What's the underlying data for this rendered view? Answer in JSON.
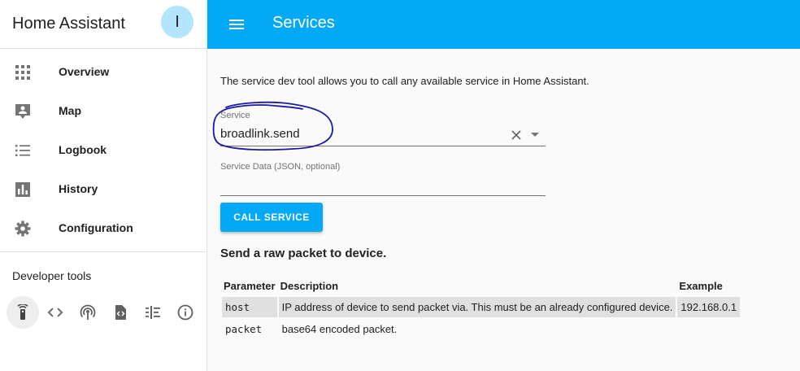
{
  "app": {
    "title": "Home Assistant",
    "avatar_initial": "I"
  },
  "sidebar": {
    "items": [
      {
        "label": "Overview",
        "icon": "grid-icon"
      },
      {
        "label": "Map",
        "icon": "map-marker-icon"
      },
      {
        "label": "Logbook",
        "icon": "list-icon"
      },
      {
        "label": "History",
        "icon": "chart-bar-icon"
      },
      {
        "label": "Configuration",
        "icon": "gear-icon"
      }
    ],
    "dev_tools_label": "Developer tools",
    "dev_tools": [
      {
        "icon": "remote-icon",
        "active": true
      },
      {
        "icon": "code-icon",
        "active": false
      },
      {
        "icon": "broadcast-icon",
        "active": false
      },
      {
        "icon": "file-code-icon",
        "active": false
      },
      {
        "icon": "timeline-icon",
        "active": false
      },
      {
        "icon": "info-icon",
        "active": false
      }
    ]
  },
  "header": {
    "title": "Services"
  },
  "main": {
    "intro": "The service dev tool allows you to call any available service in Home Assistant.",
    "service_field": {
      "label": "Service",
      "value": "broadlink.send"
    },
    "data_field": {
      "label": "Service Data (JSON, optional)",
      "value": ""
    },
    "call_button": "CALL SERVICE",
    "description": "Send a raw packet to device.",
    "table": {
      "headers": [
        "Parameter",
        "Description",
        "Example"
      ],
      "rows": [
        {
          "param": "host",
          "desc": "IP address of device to send packet via. This must be an already configured device.",
          "example": "192.168.0.1"
        },
        {
          "param": "packet",
          "desc": "base64 encoded packet.",
          "example": ""
        }
      ]
    }
  },
  "colors": {
    "accent": "#03a9f4",
    "avatar": "#b3e5fc",
    "annotation": "#1a1aa6"
  }
}
